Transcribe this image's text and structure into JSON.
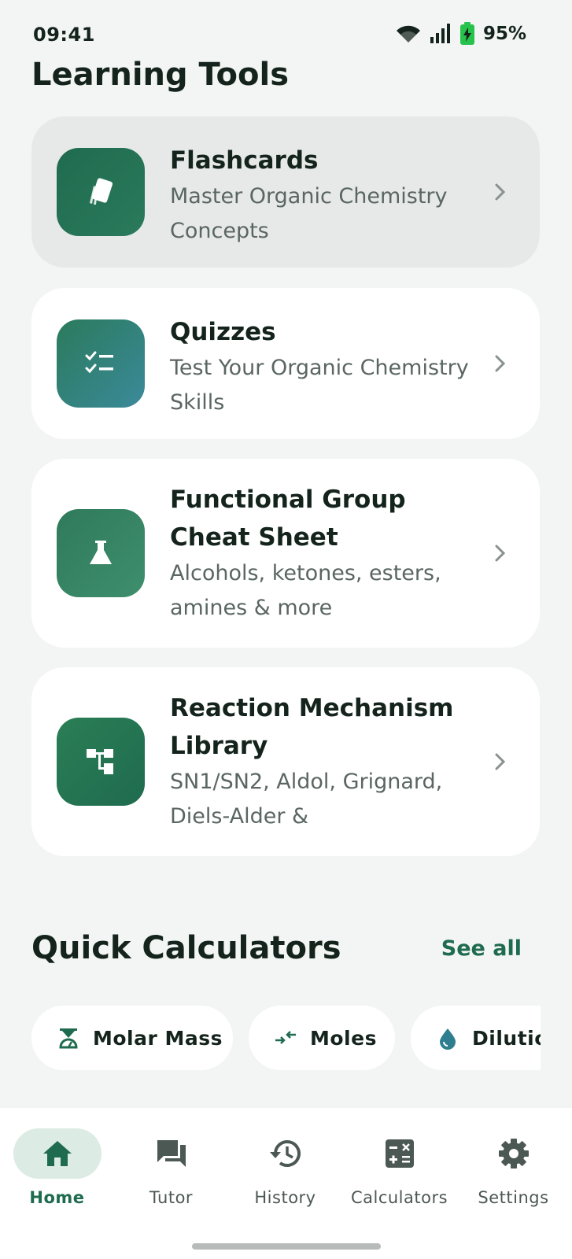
{
  "status_bar": {
    "time": "09:41",
    "battery": "95%"
  },
  "page_title": "Learning Tools",
  "cards": [
    {
      "title": "Flashcards",
      "subtitle": "Master Organic Chemistry Concepts"
    },
    {
      "title": "Quizzes",
      "subtitle": "Test Your Organic Chemistry Skills"
    },
    {
      "title": "Functional Group Cheat Sheet",
      "subtitle": "Alcohols, ketones, esters, amines & more"
    },
    {
      "title": "Reaction Mechanism Library",
      "subtitle": "SN1/SN2, Aldol, Grignard, Diels-Alder &"
    }
  ],
  "calculators_section": {
    "title": "Quick Calculators",
    "see_all": "See all",
    "chips": [
      {
        "label": "Molar Mass",
        "icon": "scale-icon"
      },
      {
        "label": "Moles",
        "icon": "convert-arrows-icon"
      },
      {
        "label": "Dilution",
        "icon": "droplet-icon"
      }
    ]
  },
  "nav": {
    "active": "Home",
    "items": [
      {
        "label": "Home",
        "icon": "home-icon"
      },
      {
        "label": "Tutor",
        "icon": "chat-icon"
      },
      {
        "label": "History",
        "icon": "history-icon"
      },
      {
        "label": "Calculators",
        "icon": "calculator-icon"
      },
      {
        "label": "Settings",
        "icon": "gear-icon"
      }
    ]
  },
  "colors": {
    "accent": "#1f6b4f",
    "background": "#f3f5f4",
    "battery": "#27c24c"
  }
}
